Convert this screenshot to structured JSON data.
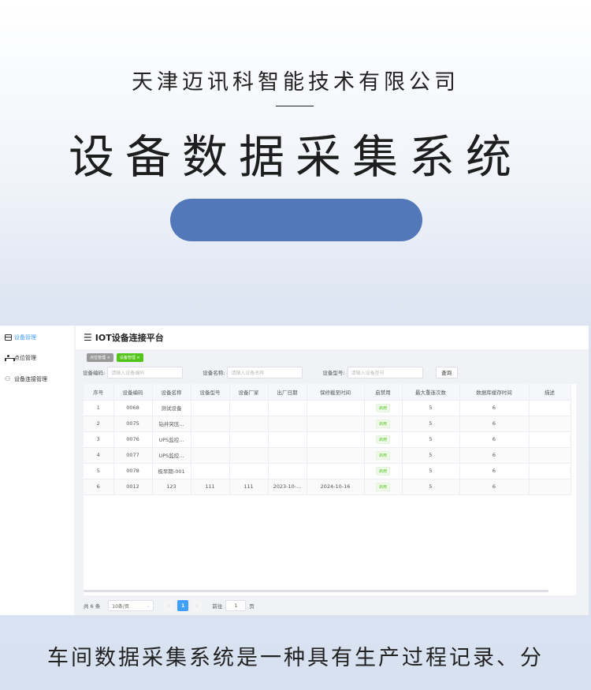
{
  "hero": {
    "company": "天津迈讯科智能技术有限公司",
    "title": "设备数据采集系统"
  },
  "sidebar": {
    "items": [
      {
        "label": "设备管理",
        "icon": "server-icon",
        "active": true
      },
      {
        "label": "点位管理",
        "icon": "node-icon",
        "active": false
      },
      {
        "label": "设备连接管理",
        "icon": "link-icon",
        "active": false
      }
    ]
  },
  "topbar": {
    "menu_icon": "menu-fold-icon",
    "title": "IOT设备连接平台"
  },
  "tags": [
    {
      "label": "点位管理",
      "close": "×"
    },
    {
      "label": "设备管理",
      "close": "×"
    }
  ],
  "filters": {
    "code_label": "设备编码:",
    "code_placeholder": "请输入设备编码",
    "name_label": "设备名称:",
    "name_placeholder": "请输入设备名称",
    "model_label": "设备型号:",
    "model_placeholder": "请输入设备型号",
    "query_button": "查询"
  },
  "table": {
    "columns": [
      "序号",
      "设备编码",
      "设备名称",
      "设备型号",
      "设备厂家",
      "出厂日期",
      "保修截至时间",
      "启禁用",
      "最大重连次数",
      "数据库缓存时间",
      "描述"
    ],
    "rows": [
      [
        "1",
        "0068",
        "测试设备",
        "",
        "",
        "",
        "",
        "启用",
        "5",
        "6",
        ""
      ],
      [
        "2",
        "0075",
        "钻井突压...",
        "",
        "",
        "",
        "",
        "启用",
        "5",
        "6",
        ""
      ],
      [
        "3",
        "0076",
        "UPS监控...",
        "",
        "",
        "",
        "",
        "启用",
        "5",
        "6",
        ""
      ],
      [
        "4",
        "0077",
        "UPS监控...",
        "",
        "",
        "",
        "",
        "启用",
        "5",
        "6",
        ""
      ],
      [
        "5",
        "0078",
        "极早期-001",
        "",
        "",
        "",
        "",
        "启用",
        "5",
        "6",
        ""
      ],
      [
        "6",
        "0012",
        "123",
        "111",
        "111",
        "2023-10-...",
        "2024-10-16",
        "启用",
        "5",
        "6",
        ""
      ]
    ]
  },
  "pager": {
    "total": "共 6 条",
    "page_size": "10条/页",
    "prev": "‹",
    "current": "1",
    "next": "›",
    "goto_label": "前往",
    "goto_value": "1",
    "page_word": "页"
  },
  "footer": {
    "text": "车间数据采集系统是一种具有生产过程记录、分"
  },
  "colors": {
    "accent": "#409eff",
    "pill": "#5378ba",
    "enabled": "#52c41a"
  }
}
